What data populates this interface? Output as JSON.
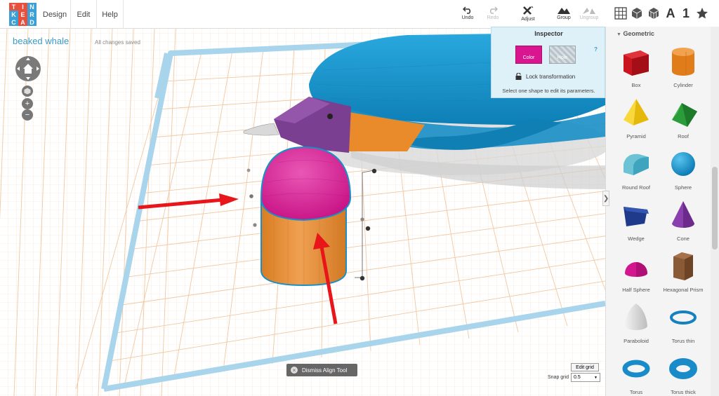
{
  "logo": {
    "letters": [
      "T",
      "I",
      "N",
      "K",
      "E",
      "R",
      "C",
      "A",
      "D"
    ],
    "colors": [
      "#e84f3d",
      "#e84f3d",
      "#3aa0d5",
      "#3aa0d5",
      "#e84f3d",
      "#3aa0d5",
      "#3aa0d5",
      "#e84f3d",
      "#3aa0d5"
    ]
  },
  "menu": {
    "design": "Design",
    "edit": "Edit",
    "help": "Help"
  },
  "toolbar": {
    "undo": "Undo",
    "redo": "Redo",
    "adjust": "Adjust",
    "group": "Group",
    "ungroup": "Ungroup",
    "view_letter": "A",
    "view_number": "1"
  },
  "project": {
    "title": "beaked whale",
    "status": "All changes saved"
  },
  "nav": {
    "zoom_in": "+",
    "zoom_out": "−"
  },
  "inspector": {
    "title": "Inspector",
    "help": "?",
    "color_label": "Color",
    "hole_label": "Hole",
    "lock_label": "Lock transformation",
    "hint": "Select one shape to edit its parameters.",
    "selected_color": "#d9168f"
  },
  "shapes_panel": {
    "header": "Geometric",
    "collapse": "❯",
    "shapes": [
      {
        "name": "Box",
        "icon": "box-icon"
      },
      {
        "name": "Cylinder",
        "icon": "cylinder-icon"
      },
      {
        "name": "Pyramid",
        "icon": "pyramid-icon"
      },
      {
        "name": "Roof",
        "icon": "roof-icon"
      },
      {
        "name": "Round Roof",
        "icon": "round-roof-icon"
      },
      {
        "name": "Sphere",
        "icon": "sphere-icon"
      },
      {
        "name": "Wedge",
        "icon": "wedge-icon"
      },
      {
        "name": "Cone",
        "icon": "cone-icon"
      },
      {
        "name": "Half Sphere",
        "icon": "half-sphere-icon"
      },
      {
        "name": "Hexagonal Prism",
        "icon": "hexagonal-prism-icon"
      },
      {
        "name": "Paraboloid",
        "icon": "paraboloid-icon"
      },
      {
        "name": "Torus thin",
        "icon": "torus-thin-icon"
      },
      {
        "name": "Torus",
        "icon": "torus-icon"
      },
      {
        "name": "Torus thick",
        "icon": "torus-thick-icon"
      }
    ]
  },
  "align": {
    "dismiss": "Dismiss Align Tool",
    "dismiss_x": "×"
  },
  "grid": {
    "edit": "Edit grid",
    "snap_label": "Snap grid",
    "snap_value": "0.5"
  },
  "colors": {
    "whale_body": "#1796cf",
    "whale_beak": "#7b3f91",
    "whale_belly": "#ea8b2a",
    "tooth": "#d8d8d8",
    "half_sphere": "#d8259a",
    "cylinder": "#e9913a",
    "arrow": "#e8161b",
    "grid_line": "#f2c9a5",
    "workplane_border": "#a8d4eb"
  }
}
